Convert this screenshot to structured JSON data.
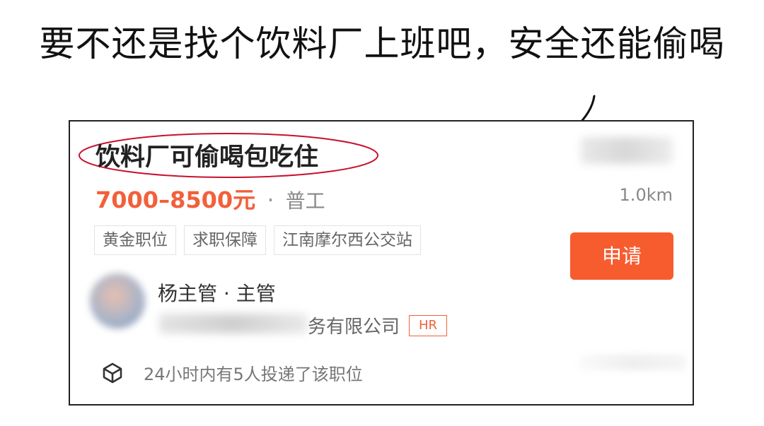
{
  "caption": "要不还是找个饮料厂上班吧，安全还能偷喝",
  "job": {
    "title": "饮料厂可偷喝包吃住",
    "salary": "7000–8500元",
    "separator": "·",
    "type": "普工",
    "distance": "1.0km",
    "tags": [
      "黄金职位",
      "求职保障",
      "江南摩尔西公交站"
    ],
    "apply_label": "申请",
    "recruiter": "杨主管 · 主管",
    "company_visible": "务有限公司",
    "hr_badge": "HR",
    "footer": "24小时内有5人投递了该职位"
  },
  "colors": {
    "accent": "#f75c2f",
    "salary": "#f2603a",
    "annotation": "#c8102e"
  },
  "icons": {
    "footer": "cube-icon"
  }
}
